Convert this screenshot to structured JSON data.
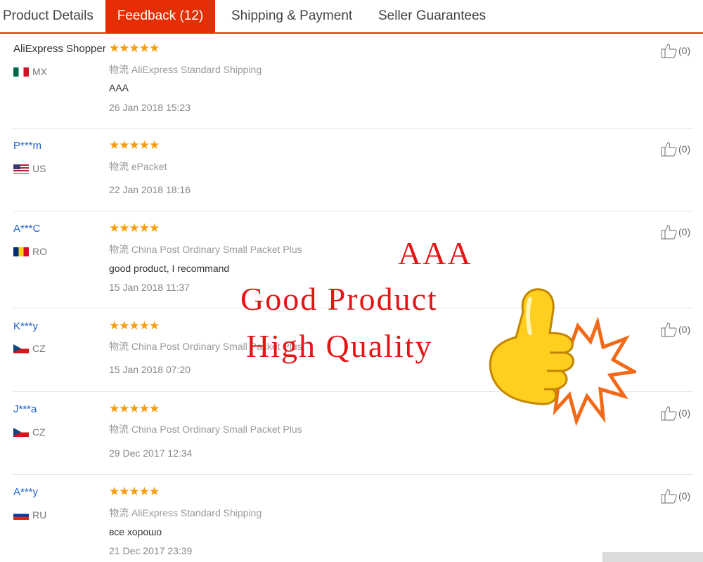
{
  "tabs": [
    {
      "label": "Product Details",
      "active": false
    },
    {
      "label": "Feedback (12)",
      "active": true
    },
    {
      "label": "Shipping & Payment",
      "active": false
    },
    {
      "label": "Seller Guarantees",
      "active": false
    }
  ],
  "feedback": [
    {
      "user": "AliExpress Shopper",
      "country": "MX",
      "stars": "★★★★★",
      "shipping": "物流 AliExpress Standard Shipping",
      "comment": "AAA",
      "date": "26 Jan 2018 15:23",
      "likes": "(0)"
    },
    {
      "user": "P***m",
      "country": "US",
      "stars": "★★★★★",
      "shipping": "物流 ePacket",
      "comment": "",
      "date": "22 Jan 2018 18:16",
      "likes": "(0)"
    },
    {
      "user": "A***C",
      "country": "RO",
      "stars": "★★★★★",
      "shipping": "物流 China Post Ordinary Small Packet Plus",
      "comment": "good product, I recommand",
      "date": "15 Jan 2018 11:37",
      "likes": "(0)"
    },
    {
      "user": "K***y",
      "country": "CZ",
      "stars": "★★★★★",
      "shipping": "物流 China Post Ordinary Small Packet Plus",
      "comment": "",
      "date": "15 Jan 2018 07:20",
      "likes": "(0)"
    },
    {
      "user": "J***a",
      "country": "CZ",
      "stars": "★★★★★",
      "shipping": "物流 China Post Ordinary Small Packet Plus",
      "comment": "",
      "date": "29 Dec 2017 12:34",
      "likes": "(0)"
    },
    {
      "user": "A***y",
      "country": "RU",
      "stars": "★★★★★",
      "shipping": "物流 AliExpress Standard Shipping",
      "comment": "все хорошо",
      "date": "21 Dec 2017 23:39",
      "likes": "(0)"
    }
  ],
  "promo": {
    "line1": "AAA",
    "line2": "Good Product",
    "line3": "High Quality"
  },
  "colors": {
    "accent": "#e62e04",
    "star": "#f79c0b",
    "username_link": "#1f62c9",
    "promo_text": "#e31515"
  }
}
